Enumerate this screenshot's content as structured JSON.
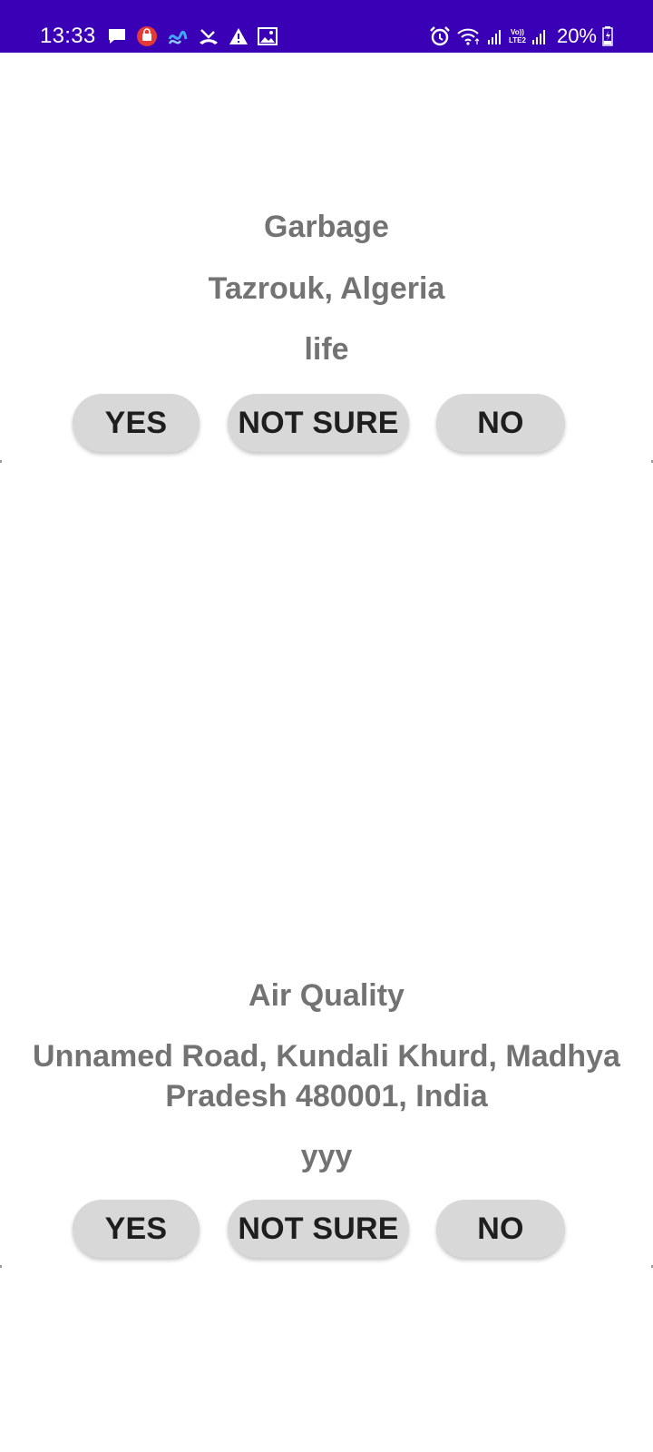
{
  "status_bar": {
    "time": "13:33",
    "battery": "20%",
    "network_label_top": "Vo))",
    "network_label_bottom": "LTE2",
    "left_icons": [
      "message-icon",
      "shop-icon",
      "app-icon",
      "missed-call-icon",
      "warning-icon",
      "image-icon"
    ],
    "right_icons": [
      "alarm-icon",
      "wifi-icon",
      "signal-icon",
      "signal-icon",
      "battery-charging-icon"
    ],
    "background_color": "#3a00b5"
  },
  "reports": [
    {
      "category": "Garbage",
      "location": "Tazrouk, Algeria",
      "note": "life",
      "buttons": {
        "yes": "YES",
        "not_sure": "NOT SURE",
        "no": "NO"
      }
    },
    {
      "category": "Air Quality",
      "location": "Unnamed Road, Kundali Khurd, Madhya Pradesh 480001, India",
      "note": "yyy",
      "buttons": {
        "yes": "YES",
        "not_sure": "NOT SURE",
        "no": "NO"
      }
    }
  ],
  "colors": {
    "text_gray": "#737373",
    "button_bg": "#d8d8d8",
    "button_text": "#1e1e1e"
  }
}
